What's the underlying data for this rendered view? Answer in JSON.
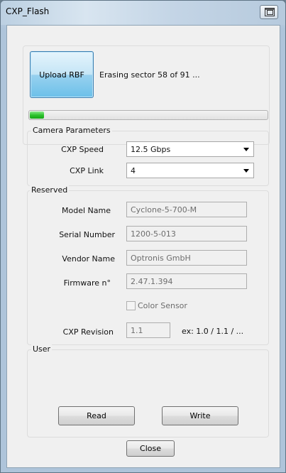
{
  "window": {
    "title": "CXP_Flash"
  },
  "flash": {
    "upload_label": "Upload RBF",
    "status": "Erasing sector 58 of 91 ...",
    "progress_fraction": 0.06
  },
  "camera": {
    "title": "Camera Parameters",
    "speed_label": "CXP Speed",
    "speed_value": "12.5 Gbps",
    "link_label": "CXP Link",
    "link_value": "4"
  },
  "reserved": {
    "title": "Reserved",
    "model_label": "Model Name",
    "model_value": "Cyclone-5-700-M",
    "serial_label": "Serial Number",
    "serial_value": "1200-5-013",
    "vendor_label": "Vendor Name",
    "vendor_value": "Optronis GmbH",
    "firmware_label": "Firmware n°",
    "firmware_value": "2.47.1.394",
    "color_sensor_label": "Color Sensor",
    "revision_label": "CXP Revision",
    "revision_value": "1.1",
    "revision_hint": "ex: 1.0 / 1.1 / ..."
  },
  "user": {
    "title": "User",
    "read_label": "Read",
    "write_label": "Write"
  },
  "close_label": "Close",
  "icons": {
    "titlebar": "restore-window-icon",
    "dropdown": "chevron-down-icon"
  }
}
